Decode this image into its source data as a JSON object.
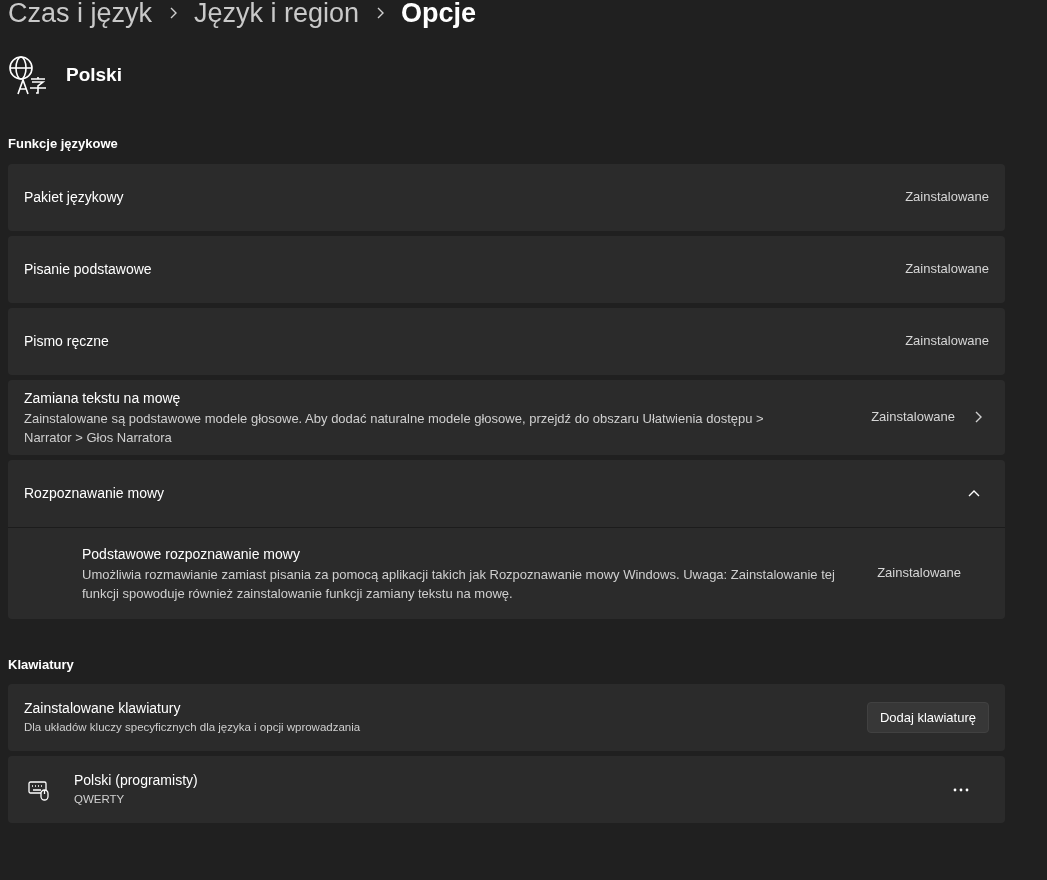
{
  "breadcrumb": [
    {
      "label": "Czas i język",
      "current": false
    },
    {
      "label": "Język i region",
      "current": false
    },
    {
      "label": "Opcje",
      "current": true
    }
  ],
  "language": {
    "name": "Polski"
  },
  "features": {
    "title": "Funkcje językowe",
    "items": [
      {
        "kind": "status",
        "title": "Pakiet językowy",
        "status": "Zainstalowane"
      },
      {
        "kind": "status",
        "title": "Pisanie podstawowe",
        "status": "Zainstalowane"
      },
      {
        "kind": "status",
        "title": "Pismo ręczne",
        "status": "Zainstalowane"
      },
      {
        "kind": "link",
        "title": "Zamiana tekstu na mowę",
        "description": "Zainstalowane są podstawowe modele głosowe. Aby dodać naturalne modele głosowe, przejdź do obszaru Ułatwienia dostępu > Narrator > Głos Narratora",
        "status": "Zainstalowane"
      },
      {
        "kind": "expander",
        "title": "Rozpoznawanie mowy",
        "expanded": true,
        "children": [
          {
            "title": "Podstawowe rozpoznawanie mowy",
            "description": "Umożliwia rozmawianie zamiast pisania za pomocą aplikacji takich jak Rozpoznawanie mowy Windows. Uwaga: Zainstalowanie tej funkcji spowoduje również zainstalowanie funkcji zamiany tekstu na mowę.",
            "status": "Zainstalowane"
          }
        ]
      }
    ]
  },
  "keyboards": {
    "title": "Klawiatury",
    "header": {
      "title": "Zainstalowane klawiatury",
      "description": "Dla układów kluczy specyficznych dla języka i opcji wprowadzania",
      "button": "Dodaj klawiaturę"
    },
    "items": [
      {
        "name": "Polski (programisty)",
        "layout": "QWERTY"
      }
    ]
  }
}
